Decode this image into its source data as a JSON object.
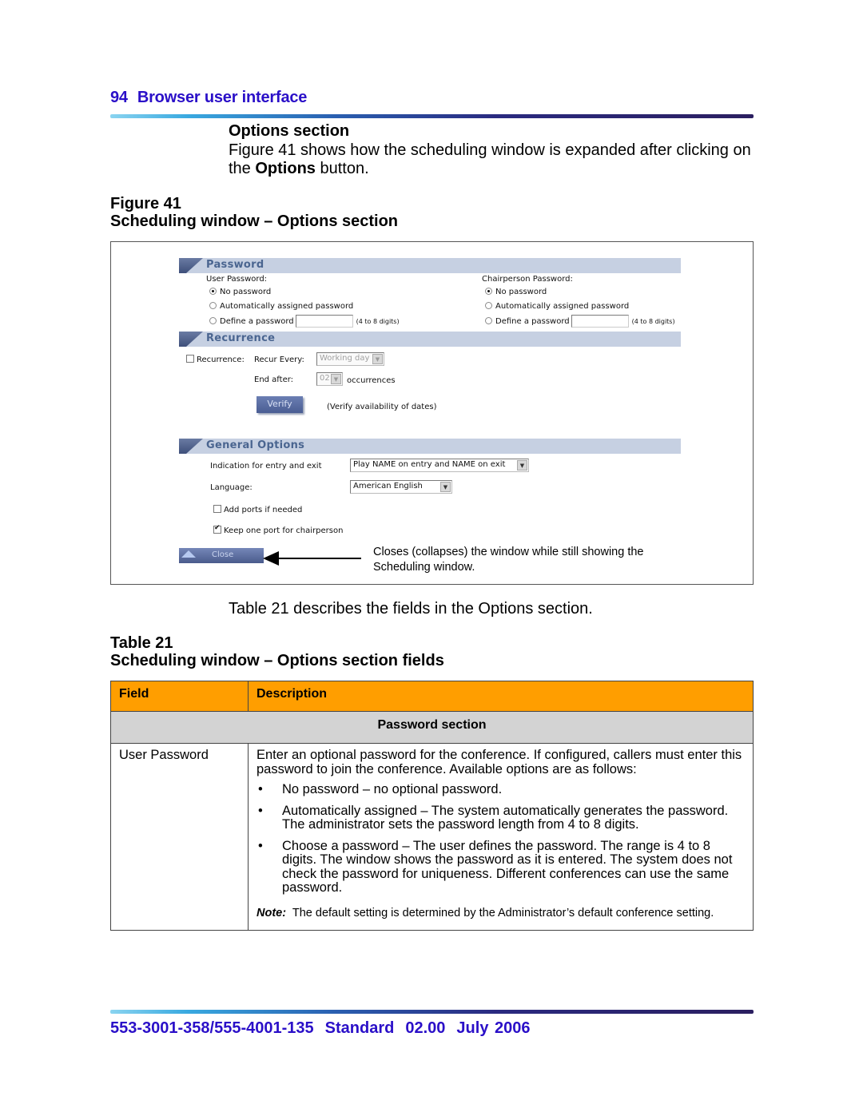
{
  "header": {
    "page_number": "94",
    "chapter": "Browser user interface"
  },
  "section": {
    "title": "Options section",
    "intro_before": "Figure 41 shows how the scheduling window is expanded after clicking on the ",
    "intro_bold": "Options",
    "intro_after": " button."
  },
  "figure": {
    "label": "Figure 41",
    "title": "Scheduling window – Options section",
    "password": {
      "heading": "Password",
      "user": {
        "label": "User Password:",
        "options": [
          "No password",
          "Automatically assigned password",
          "Define a password"
        ],
        "selected": 0,
        "input_value": "",
        "hint": "(4 to 8 digits)"
      },
      "chair": {
        "label": "Chairperson Password:",
        "options": [
          "No password",
          "Automatically assigned password",
          "Define a password"
        ],
        "selected": 0,
        "input_value": "",
        "hint": "(4 to 8 digits)"
      }
    },
    "recurrence": {
      "heading": "Recurrence",
      "checkbox_label": "Recurrence:",
      "checked": false,
      "recur_every_label": "Recur Every:",
      "recur_every_value": "Working day",
      "end_after_label": "End after:",
      "end_after_value": "02",
      "occurrences_label": "occurrences",
      "verify_button": "Verify",
      "verify_hint": "(Verify availability of dates)"
    },
    "general": {
      "heading": "General Options",
      "indication_label": "Indication for entry and exit",
      "indication_value": "Play NAME on entry and NAME on exit",
      "language_label": "Language:",
      "language_value": "American English",
      "add_ports_label": "Add ports if needed",
      "add_ports_checked": false,
      "keep_port_label": "Keep one port for chairperson",
      "keep_port_checked": true
    },
    "close_button": "Close",
    "callout": "Closes (collapses) the window while still showing the Scheduling window."
  },
  "table_intro": "Table 21 describes the fields in the Options section.",
  "table": {
    "label": "Table 21",
    "title": "Scheduling window – Options section fields",
    "headers": [
      "Field",
      "Description"
    ],
    "subheader": "Password section",
    "rows": [
      {
        "field": "User Password",
        "description": "Enter an optional password for the conference. If configured, callers must enter this password to join the conference. Available options are as follows:",
        "bullets": [
          "No password – no optional password.",
          "Automatically assigned – The system automatically generates the password. The administrator sets the password length from 4 to 8 digits.",
          "Choose a password – The user defines the password. The range is 4 to 8 digits. The window shows the password as it is entered. The system does not check the password for uniqueness. Different conferences can use the same password."
        ],
        "note_label": "Note:",
        "note": "The default setting is determined by the Administrator’s default conference setting."
      }
    ]
  },
  "footer": {
    "doc_number": "553-3001-358/555-4001-135",
    "status": "Standard",
    "version": "02.00",
    "date": "July 2006"
  },
  "colors": {
    "heading_blue": "#2a0fc8",
    "table_header": "#ff9e00",
    "table_subheader": "#d3d3d3",
    "ui_section_bar": "#c6d0e2"
  }
}
